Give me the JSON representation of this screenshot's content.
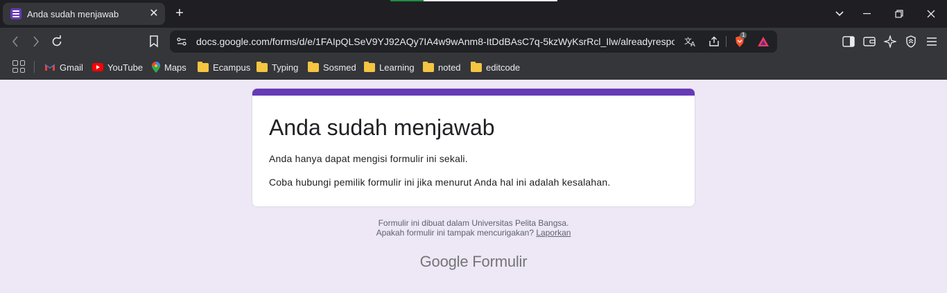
{
  "browser": {
    "tab": {
      "title": "Anda sudah menjawab",
      "close": "✕"
    },
    "new_tab": "+",
    "url": "docs.google.com/forms/d/e/1FAIpQLSeV9YJ92AQy7IA4w9wAnm8-ItDdBAsC7q-5kzWyKsrRcl_Ilw/alreadyrespo...",
    "brave_badge": "1",
    "bookmarks": [
      "Gmail",
      "YouTube",
      "Maps",
      "Ecampus",
      "Typing",
      "Sosmed",
      "Learning",
      "noted",
      "editcode"
    ]
  },
  "card": {
    "accent_color": "#673ab7",
    "title": "Anda sudah menjawab",
    "line1": "Anda hanya dapat mengisi formulir ini sekali.",
    "line2": "Coba hubungi pemilik formulir ini jika menurut Anda hal ini adalah kesalahan."
  },
  "footer": {
    "created_in": "Formulir ini dibuat dalam Universitas Pelita Bangsa.",
    "suspicious": "Apakah formulir ini tampak mencurigakan?",
    "report_link": "Laporkan",
    "brand_google": "Google",
    "brand_product": "Formulir"
  }
}
